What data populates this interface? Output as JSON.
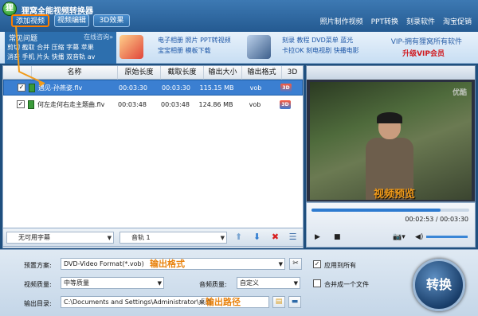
{
  "app": {
    "title": "狸窝全能视频转换器",
    "icon_letter": "狸"
  },
  "tabs": [
    {
      "label": "添加视频",
      "active": true
    },
    {
      "label": "视频编辑",
      "active": false
    },
    {
      "label": "3D效果",
      "active": false
    }
  ],
  "top_links": [
    "照片制作视频",
    "PPT转换",
    "刻录软件",
    "淘宝促销"
  ],
  "faq": {
    "title": "常见问题",
    "online": "在线咨询»",
    "row1": "剪切 截取 合并 压缩 字幕 苹果",
    "row2": "消音 手机 片头 快播 双音轨 av"
  },
  "promo": {
    "group1_line1": "电子相册 照片 PPT转视频",
    "group1_line2": "宝宝相册 模板下载",
    "group2_line1": "刻录 教程 DVD菜单 蓝光",
    "group2_line2": "卡拉OK 刻电视剧 快播电影",
    "vip_line1": "VIP-拥有狸窝所有软件",
    "vip_line2": "升级VIP会员"
  },
  "table": {
    "headers": [
      "名称",
      "原始长度",
      "截取长度",
      "输出大小",
      "输出格式",
      "3D"
    ],
    "rows": [
      {
        "checked": true,
        "name": "遇见-孙燕姿.flv",
        "orig": "00:03:30",
        "cut": "00:03:30",
        "size": "115.15 MB",
        "format": "vob",
        "selected": true
      },
      {
        "checked": true,
        "name": "何左走何右走主题曲.flv",
        "orig": "00:03:48",
        "cut": "00:03:48",
        "size": "124.86 MB",
        "format": "vob",
        "selected": false
      }
    ]
  },
  "bottom_bar": {
    "subtitle": "无可用字幕",
    "audio_track": "音轨 1"
  },
  "preview": {
    "watermark": "优酷",
    "overlay_label": "视频预览",
    "time": "00:02:53 / 00:03:30",
    "progress": 0.82
  },
  "settings": {
    "preset_label": "预置方案:",
    "preset_value": "DVD-Video Format(*.vob)",
    "preset_annot": "输出格式",
    "apply_all": "应用到所有",
    "video_quality_label": "视频质量:",
    "video_quality_value": "中等质量",
    "audio_quality_label": "音频质量:",
    "audio_quality_value": "自定义",
    "merge_label": "合并成一个文件",
    "output_label": "输出目录:",
    "output_value": "C:\\Documents and Settings\\Administrator\\桌面",
    "output_annot": "输出路径",
    "convert_label": "转换"
  },
  "colors": {
    "accent_orange": "#f19b1a",
    "brand_blue": "#2d6fae",
    "selection": "#3b7fd1"
  }
}
